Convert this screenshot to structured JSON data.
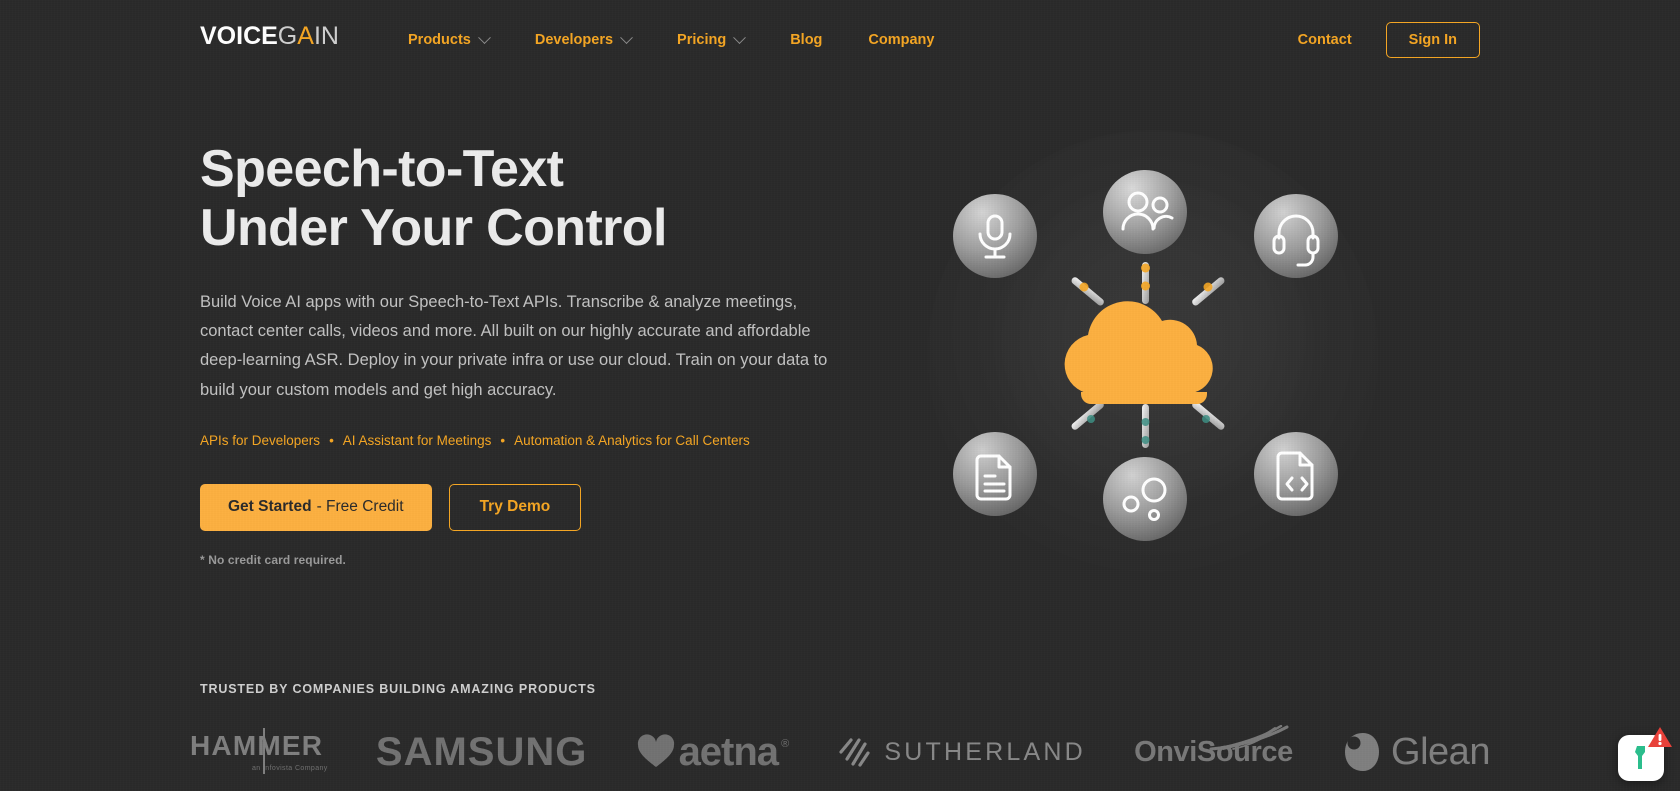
{
  "brand": {
    "logo_voice": "VOICE",
    "logo_gain_g": "G",
    "logo_gain_a": "A",
    "logo_gain_i": "I",
    "logo_gain_n": "N",
    "accent_color": "#f5a623",
    "cta_color": "#fcb040",
    "background_color": "#2a2a2a"
  },
  "header": {
    "nav": [
      {
        "label": "Products",
        "has_dropdown": true
      },
      {
        "label": "Developers",
        "has_dropdown": true
      },
      {
        "label": "Pricing",
        "has_dropdown": true
      },
      {
        "label": "Blog",
        "has_dropdown": false
      },
      {
        "label": "Company",
        "has_dropdown": false
      }
    ],
    "contact_label": "Contact",
    "signin_label": "Sign In"
  },
  "hero": {
    "headline_line1": "Speech-to-Text",
    "headline_line2": "Under Your Control",
    "subcopy": "Build Voice AI apps with our Speech-to-Text APIs. Transcribe & analyze meetings, contact center calls, videos and more. All built on our highly accurate and affordable deep-learning ASR. Deploy in your private infra or use our cloud. Train on your data to build your custom models and get high accuracy.",
    "links": [
      "APIs for Developers",
      "AI Assistant for Meetings",
      "Automation & Analytics for Call Centers"
    ],
    "link_separator": "•",
    "cta_primary_strong": "Get Started",
    "cta_primary_light": "- Free Credit",
    "cta_secondary": "Try Demo",
    "fineprint": "* No credit card required."
  },
  "graphic": {
    "center_icon": "cloud-icon",
    "nodes": [
      {
        "name": "microphone-icon",
        "position": "top-left"
      },
      {
        "name": "people-group-icon",
        "position": "top"
      },
      {
        "name": "headset-icon",
        "position": "top-right"
      },
      {
        "name": "document-lines-icon",
        "position": "bottom-left"
      },
      {
        "name": "nodes-bubbles-icon",
        "position": "bottom"
      },
      {
        "name": "code-document-icon",
        "position": "bottom-right"
      }
    ]
  },
  "trusted": {
    "label": "TRUSTED BY COMPANIES BUILDING AMAZING PRODUCTS",
    "logos": [
      {
        "name": "hammer",
        "text": "HAMMER",
        "sub": "an Infovista Company"
      },
      {
        "name": "samsung",
        "text": "SAMSUNG",
        "sub": ""
      },
      {
        "name": "aetna",
        "text": "aetna",
        "sub": "®"
      },
      {
        "name": "sutherland",
        "text": "SUTHERLAND",
        "sub": ""
      },
      {
        "name": "onvisource",
        "text": "OnviSource",
        "sub": ""
      },
      {
        "name": "glean",
        "text": "Glean",
        "sub": ""
      }
    ]
  },
  "widget": {
    "name": "chat-widget",
    "badge": "warning-triangle-icon",
    "badge_color": "#e8413a",
    "figure_color": "#2bbd8c"
  }
}
